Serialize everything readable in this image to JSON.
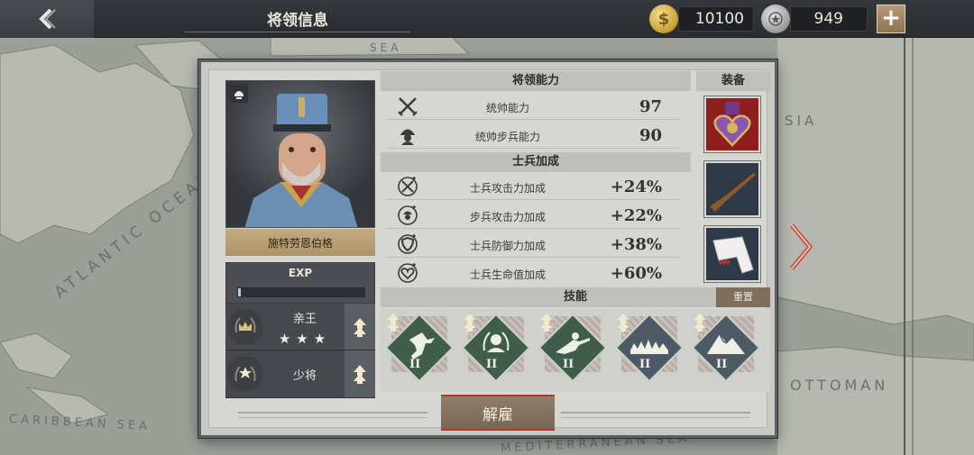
{
  "header": {
    "title": "将领信息",
    "gold": "10100",
    "silver": "949",
    "gold_symbol": "$"
  },
  "map": {
    "labels": [
      "SEA",
      "ATLANTIC OCEAN",
      "CARIBBEAN SEA",
      "MEDITERRANEAN SEA",
      "OTTOMAN",
      "SIA"
    ]
  },
  "general": {
    "name": "施特劳恩伯格",
    "exp_label": "EXP",
    "exp_progress": 0.02,
    "rank_title": "亲王",
    "rank_stars": "★★★",
    "military_rank": "少将"
  },
  "sections": {
    "abilities": "将领能力",
    "soldier_bonus": "士兵加成",
    "skills": "技能",
    "equipment": "装备",
    "reset": "重置"
  },
  "abilities": [
    {
      "label": "统帅能力",
      "value": "97",
      "icon": "crossed-swords-icon"
    },
    {
      "label": "统帅步兵能力",
      "value": "90",
      "icon": "infantry-helmet-icon"
    }
  ],
  "bonuses": [
    {
      "label": "士兵攻击力加成",
      "value": "+24%",
      "icon": "attack-bonus-icon"
    },
    {
      "label": "步兵攻击力加成",
      "value": "+22%",
      "icon": "infantry-attack-icon"
    },
    {
      "label": "士兵防御力加成",
      "value": "+38%",
      "icon": "shield-icon"
    },
    {
      "label": "士兵生命值加成",
      "value": "+60%",
      "icon": "heart-icon"
    }
  ],
  "equipment": [
    {
      "name": "purple-heart-medal-icon"
    },
    {
      "name": "rifle-icon"
    },
    {
      "name": "scarf-icon"
    }
  ],
  "skills": [
    {
      "name": "charging-soldier-icon",
      "level": "II",
      "color": "#3f5c4c"
    },
    {
      "name": "laurel-soldier-icon",
      "level": "II",
      "color": "#3f5c4c"
    },
    {
      "name": "prone-soldier-icon",
      "level": "II",
      "color": "#3f5c4c"
    },
    {
      "name": "fortification-icon",
      "level": "II",
      "color": "#4d5a66"
    },
    {
      "name": "mountain-icon",
      "level": "II",
      "color": "#4d5a66"
    }
  ],
  "actions": {
    "dismiss": "解雇"
  }
}
